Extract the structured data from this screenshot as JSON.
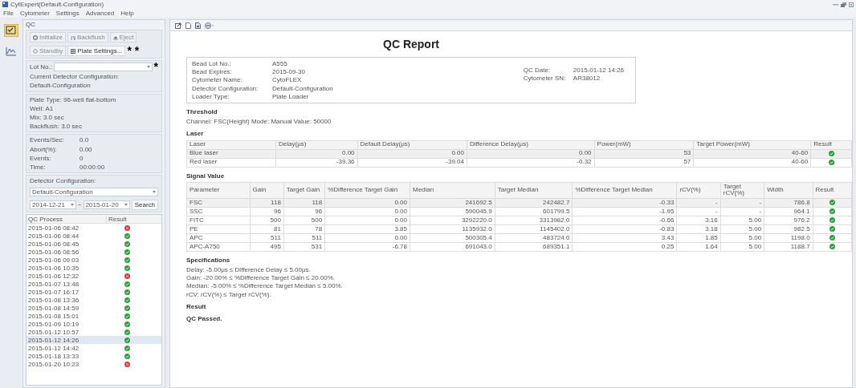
{
  "window": {
    "title": "CytExpert(Default-Configuration)"
  },
  "menu": [
    "File",
    "Cytometer",
    "Settings",
    "Advanced",
    "Help"
  ],
  "nav": [
    {
      "kind": "qc",
      "selected": true
    },
    {
      "kind": "chart",
      "selected": false
    }
  ],
  "qc_panel": {
    "title": "QC",
    "buttons": [
      {
        "kind": "initialize",
        "label": "Initialize",
        "disabled": true
      },
      {
        "kind": "backflush",
        "label": "Backflush",
        "disabled": true
      },
      {
        "kind": "eject",
        "label": "Eject",
        "disabled": true
      },
      {
        "kind": "standby",
        "label": "Standby",
        "disabled": true
      },
      {
        "kind": "plate",
        "label": "Plate Settings...",
        "disabled": false
      }
    ],
    "button_mark": "* *",
    "lot": {
      "label": "Lot No.:",
      "mark": "*"
    },
    "current_config_label": "Current Detector Configuration:",
    "current_config": "Default-Configuration",
    "plate_info": [
      "Plate Type:  96-well flat-bottom",
      "Well:  A1",
      "Mix:  3.0 sec",
      "Backflush:  3.0 sec"
    ],
    "stats": [
      {
        "label": "Events/Sec:",
        "value": "0.0"
      },
      {
        "label": "Abort(%):",
        "value": "0.00"
      },
      {
        "label": "Events:",
        "value": "0"
      },
      {
        "label": "Time:",
        "value": "00:00:00"
      }
    ],
    "detector": {
      "label": "Detector Configuration:",
      "value": "Default-Configuration",
      "date_from": "2014-12-21",
      "separator": "~",
      "date_to": "2015-01-20",
      "search": "Search"
    },
    "qc_list": {
      "columns": [
        "QC Process",
        "Result"
      ],
      "rows": [
        {
          "time": "2015-01-06 08:42",
          "passed": false,
          "selected": false
        },
        {
          "time": "2015-01-06 08:44",
          "passed": true,
          "selected": false
        },
        {
          "time": "2015-01-06 08:45",
          "passed": true,
          "selected": false
        },
        {
          "time": "2015-01-06 08:56",
          "passed": true,
          "selected": false
        },
        {
          "time": "2015-01-06 09:03",
          "passed": true,
          "selected": false
        },
        {
          "time": "2015-01-06 10:35",
          "passed": true,
          "selected": false
        },
        {
          "time": "2015-01-06 12:32",
          "passed": false,
          "selected": false
        },
        {
          "time": "2015-01-07 13:48",
          "passed": true,
          "selected": false
        },
        {
          "time": "2015-01-07 16:17",
          "passed": true,
          "selected": false
        },
        {
          "time": "2015-01-08 13:36",
          "passed": true,
          "selected": false
        },
        {
          "time": "2015-01-08 14:59",
          "passed": true,
          "selected": false
        },
        {
          "time": "2015-01-08 15:01",
          "passed": true,
          "selected": false
        },
        {
          "time": "2015-01-09 10:19",
          "passed": true,
          "selected": false
        },
        {
          "time": "2015-01-12 10:57",
          "passed": true,
          "selected": false
        },
        {
          "time": "2015-01-12 14:26",
          "passed": true,
          "selected": true
        },
        {
          "time": "2015-01-12 14:42",
          "passed": true,
          "selected": false
        },
        {
          "time": "2015-01-18 13:33",
          "passed": true,
          "selected": false
        },
        {
          "time": "2015-01-20 10:23",
          "passed": false,
          "selected": false
        }
      ]
    }
  },
  "report": {
    "title": "QC Report",
    "info_left": [
      {
        "label": "Bead Lot No.:",
        "value": "A555"
      },
      {
        "label": "Bead Expires:",
        "value": "2015-09-30"
      },
      {
        "label": "Cytometer Name:",
        "value": "CytoFLEX"
      },
      {
        "label": "Detector Configuration:",
        "value": "Default-Configuration"
      },
      {
        "label": "Loader Type:",
        "value": "Plate Loader"
      }
    ],
    "info_right": [
      {
        "label": "QC Date:",
        "value": "2015-01-12 14:26"
      },
      {
        "label": "Cytometer SN:",
        "value": "AR38012"
      }
    ],
    "threshold_heading": "Threshold",
    "threshold": "Channel: FSC(Height)   Mode: Manual   Value: 50000",
    "laser_heading": "Laser",
    "laser_table": {
      "columns": [
        "Laser",
        "Delay(μs)",
        "Default Delay(μs)",
        "Difference Delay(μs)",
        "Power(mW)",
        "Target Power(mW)",
        "Result"
      ],
      "rows": [
        {
          "cells": [
            "Blue laser",
            "0.00",
            "0.00",
            "0.00",
            "53",
            "40-60"
          ],
          "passed": true
        },
        {
          "cells": [
            "Red laser",
            "-39.36",
            "-39.04",
            "-0.32",
            "57",
            "40-60"
          ],
          "passed": true
        }
      ]
    },
    "signal_heading": "Signal Value",
    "signal_table": {
      "columns": [
        "Parameter",
        "Gain",
        "Target Gain",
        "%Difference Target Gain",
        "Median",
        "Target Median",
        "%Difference Target Median",
        "rCV(%)",
        "Target rCV(%)",
        "Width",
        "Result"
      ],
      "rows": [
        {
          "cells": [
            "FSC",
            "118",
            "118",
            "0.00",
            "241692.5",
            "242482.7",
            "-0.33",
            "-",
            "-",
            "786.8"
          ],
          "passed": true
        },
        {
          "cells": [
            "SSC",
            "96",
            "96",
            "0.00",
            "590045.9",
            "601799.5",
            "-1.95",
            "-",
            "-",
            "964.1"
          ],
          "passed": true
        },
        {
          "cells": [
            "FITC",
            "500",
            "500",
            "0.00",
            "3292220.0",
            "3313982.0",
            "-0.66",
            "3.16",
            "5.00",
            "976.2"
          ],
          "passed": true
        },
        {
          "cells": [
            "PE",
            "81",
            "78",
            "3.85",
            "1135932.0",
            "1145402.0",
            "-0.83",
            "3.18",
            "5.00",
            "982.5"
          ],
          "passed": true
        },
        {
          "cells": [
            "APC",
            "511",
            "511",
            "0.00",
            "500305.4",
            "483724.0",
            "3.43",
            "1.85",
            "5.00",
            "1198.0"
          ],
          "passed": true
        },
        {
          "cells": [
            "APC-A750",
            "495",
            "531",
            "-6.78",
            "691043.0",
            "689351.1",
            "0.25",
            "1.64",
            "5.00",
            "1188.7"
          ],
          "passed": true
        }
      ]
    },
    "spec_heading": "Specifications",
    "specs": [
      "Delay: -5.00μs ≤ Difference Delay ≤ 5.00μs.",
      "Gain: -20.00% ≤ %Difference Target Gain ≤ 20.00%.",
      "Median: -5.00% ≤ %Difference Target Median ≤ 5.00%.",
      "rCV: rCV(%) ≤ Target rCV(%)."
    ],
    "result_heading": "Result",
    "result": "QC Passed."
  }
}
